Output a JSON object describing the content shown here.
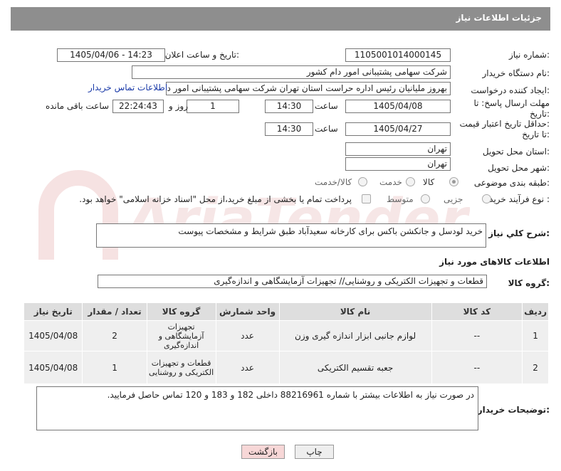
{
  "header": {
    "title": "جزئیات اطلاعات نیاز"
  },
  "form": {
    "need_number_label": "شماره نیاز:",
    "need_number": "1105001014000145",
    "announce_label": "تاریخ و ساعت اعلان عمومی:",
    "announce_value": "1405/04/06 - 14:23",
    "buyer_org_label": "نام دستگاه خریدار:",
    "buyer_org": "شرکت سهامی پشتیبانی امور دام کشور",
    "requester_label": "ایجاد کننده درخواست:",
    "requester": "بهروز ملیانیان رئیس اداره حراست استان تهران شرکت سهامی پشتیبانی امور دا",
    "contact_link": "اطلاعات تماس خریدار",
    "send_deadline_label_1": "مهلت ارسال پاسخ: تا",
    "send_deadline_label_2": "تاریخ:",
    "send_date": "1405/04/08",
    "time_label": "ساعت",
    "send_time": "14:30",
    "days_value": "1",
    "days_label": "روز و",
    "remaining_time": "22:24:43",
    "remaining_label": "ساعت باقی مانده",
    "validity_label_1": "حداقل تاریخ اعتبار قیمت:",
    "validity_label_2": "تا تاریخ:",
    "validity_date": "1405/04/27",
    "validity_time": "14:30",
    "province_label": "استان محل تحویل:",
    "province": "تهران",
    "city_label": "شهر محل تحویل:",
    "city": "تهران",
    "category_label": "طبقه بندی موضوعی:",
    "category_options": [
      "کالا",
      "خدمت",
      "کالا/خدمت"
    ],
    "category_selected": "کالا",
    "process_label": "نوع فرآیند خرید :",
    "process_options": [
      "جزیی",
      "متوسط"
    ],
    "payment_note": "پرداخت تمام یا بخشی از مبلغ خرید،از محل \"اسناد خزانه اسلامی\" خواهد بود."
  },
  "description": {
    "label": "شرح کلي نياز:",
    "value": "خرید لودسل و جانکشن باکس برای کارخانه سعیدآباد طبق شرایط و مشخصات پیوست"
  },
  "goods": {
    "section_title": "اطلاعات کالاهای مورد نیاز",
    "group_label": "گروه کالا:",
    "group_value": "قطعات و تجهیزات الکتریکی و روشنایی// تجهیزات آزمایشگاهی و اندازه‌گیری",
    "columns": [
      "ردیف",
      "کد کالا",
      "نام کالا",
      "واحد شمارش",
      "تعداد / مقدار",
      "گروه کالا",
      "تاریخ نیاز"
    ],
    "rows": [
      {
        "row": "1",
        "code": "--",
        "name": "لوازم جانبی ابزار اندازه گیری وزن",
        "unit": "عدد",
        "qty": "2",
        "group": "تجهیزات آزمایشگاهی و اندازه‌گیری",
        "date": "1405/04/08"
      },
      {
        "row": "2",
        "code": "--",
        "name": "جعبه تقسیم الکتریکی",
        "unit": "عدد",
        "qty": "1",
        "group": "قطعات و تجهیزات الکتریکی و روشنایی",
        "date": "1405/04/08"
      }
    ]
  },
  "buyer_notes": {
    "label": "توضیحات خریدار:",
    "value": "در صورت نیاز به اطلاعات بیشتر با شماره 88216961 داخلی 182 و 183 و 120 تماس حاصل فرمایید."
  },
  "buttons": {
    "print": "چاپ",
    "back": "بازگشت"
  },
  "watermark": "AriaTender.neT",
  "colors": {
    "header_bg": "#8e8e8e",
    "link": "#1a3aa8",
    "back_btn": "#f7d7d7",
    "watermark": "#f0d0d0"
  }
}
